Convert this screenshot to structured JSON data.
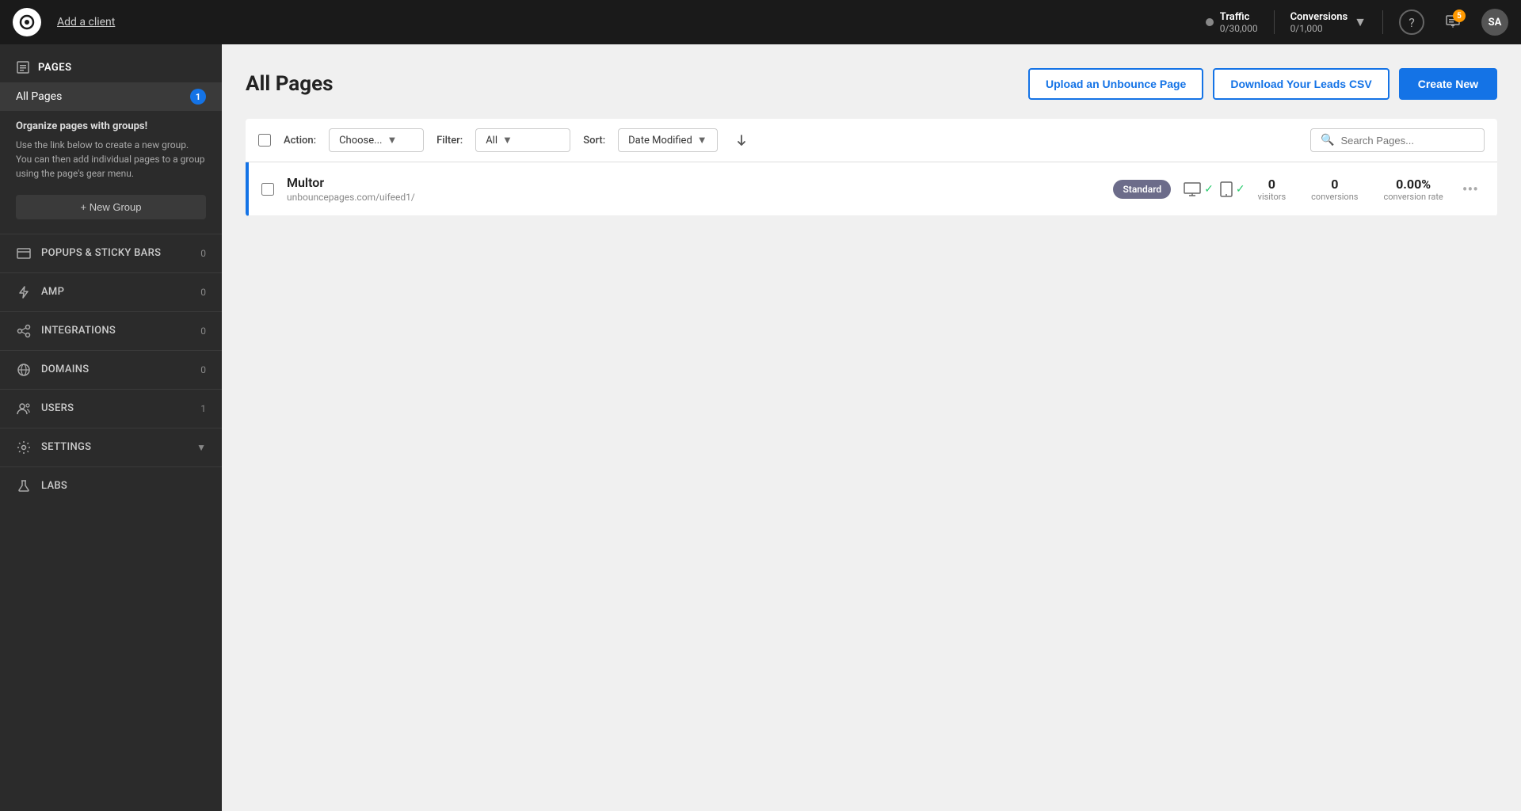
{
  "topnav": {
    "logo": "⦿",
    "add_client_label": "Add a client",
    "traffic_label": "Traffic",
    "traffic_value": "0/30,000",
    "conversions_label": "Conversions",
    "conversions_value": "0/1,000",
    "notification_count": "5",
    "avatar_initials": "SA"
  },
  "sidebar": {
    "pages_section_label": "PAGES",
    "all_pages_label": "All Pages",
    "all_pages_badge": "1",
    "group_promo_title": "Organize pages with groups!",
    "group_promo_text": "Use the link below to create a new group. You can then add individual pages to a group using the page's gear menu.",
    "new_group_label": "+ New Group",
    "nav_items": [
      {
        "icon": "popup",
        "label": "POPUPS & STICKY BARS",
        "count": "0"
      },
      {
        "icon": "amp",
        "label": "AMP",
        "count": "0"
      },
      {
        "icon": "integrations",
        "label": "INTEGRATIONS",
        "count": "0"
      },
      {
        "icon": "domains",
        "label": "DOMAINS",
        "count": "0"
      },
      {
        "icon": "users",
        "label": "USERS",
        "count": "1"
      },
      {
        "icon": "settings",
        "label": "SETTINGS",
        "arrow": "▼"
      },
      {
        "icon": "labs",
        "label": "LABS",
        "count": ""
      }
    ]
  },
  "main": {
    "page_title": "All Pages",
    "upload_btn": "Upload an Unbounce Page",
    "download_btn": "Download Your Leads CSV",
    "create_btn": "Create New",
    "toolbar": {
      "action_label": "Action:",
      "action_placeholder": "Choose...",
      "filter_label": "Filter:",
      "filter_value": "All",
      "sort_label": "Sort:",
      "sort_value": "Date Modified",
      "search_placeholder": "Search Pages..."
    },
    "pages": [
      {
        "name": "Multor",
        "url": "unbouncepages.com/uifeed1/",
        "type": "Standard",
        "desktop_active": true,
        "tablet_active": true,
        "visitors": "0",
        "conversions": "0",
        "conversion_rate": "0.00%",
        "visitors_label": "visitors",
        "conversions_label": "conversions",
        "conversion_rate_label": "conversion rate"
      }
    ]
  }
}
